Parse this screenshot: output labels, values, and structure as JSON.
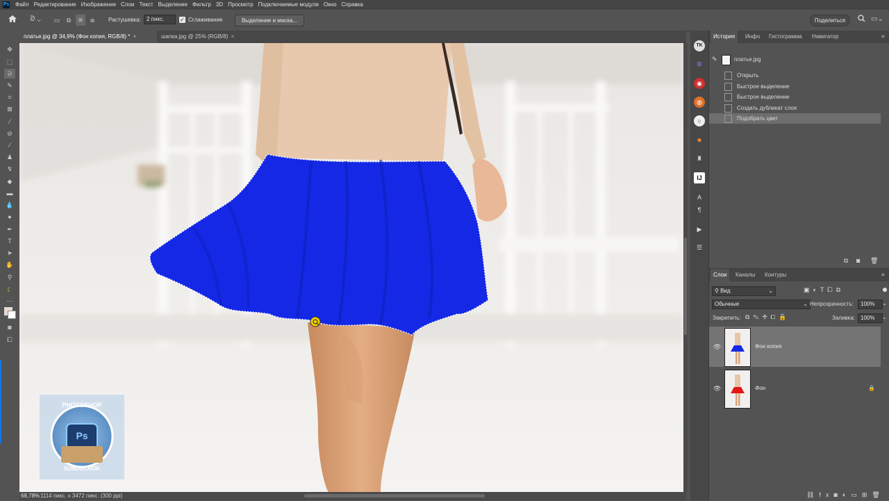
{
  "app": {
    "logo": "Ps"
  },
  "menu": [
    "Файл",
    "Редактирование",
    "Изображение",
    "Слои",
    "Текст",
    "Выделение",
    "Фильтр",
    "3D",
    "Просмотр",
    "Подключаемые модули",
    "Окно",
    "Справка"
  ],
  "options": {
    "feather_label": "Растушевка:",
    "feather_value": "2 пикс.",
    "antialias_label": "Сглаживание",
    "antialias_checked": true,
    "select_mask_button": "Выделение и маска...",
    "share_button": "Поделиться"
  },
  "doc_tabs": [
    {
      "title": "платье.jpg @ 34,9% (Фон копия, RGB/8) *",
      "active": true
    },
    {
      "title": "шапка.jpg @ 25% (RGB/8)",
      "active": false
    }
  ],
  "tab_close": "×",
  "canvas": {
    "watermark_top": "PHOTOSHOP",
    "watermark_bottom": "SUNDUCHOK",
    "watermark_logo": "Ps",
    "skirt_color": "#1428e6"
  },
  "status": {
    "zoom": "68,78%",
    "info": "1114 пикс. x 3472 пикс. (300 ppi)"
  },
  "history_panel": {
    "tabs": [
      "История",
      "Инфо",
      "Гистограмма",
      "Навигатор"
    ],
    "snapshot": "платье.jpg",
    "items": [
      "Открыть",
      "Быстрое выделение",
      "Быстрое выделение",
      "Создать дубликат слоя",
      "Подобрать цвет"
    ],
    "selected_index": 4
  },
  "layers_panel": {
    "tabs": [
      "Слои",
      "Каналы",
      "Контуры"
    ],
    "filter_label": "Вид",
    "blend_mode": "Обычные",
    "opacity_label": "Непрозрачность:",
    "opacity_value": "100%",
    "lock_label": "Закрепить:",
    "fill_label": "Заливка:",
    "fill_value": "100%",
    "layers": [
      {
        "name": "Фон копия",
        "selected": true,
        "skirt_color": "#1428e6"
      },
      {
        "name": "Фон",
        "selected": false,
        "skirt_color": "#e01818",
        "locked": true
      }
    ]
  }
}
